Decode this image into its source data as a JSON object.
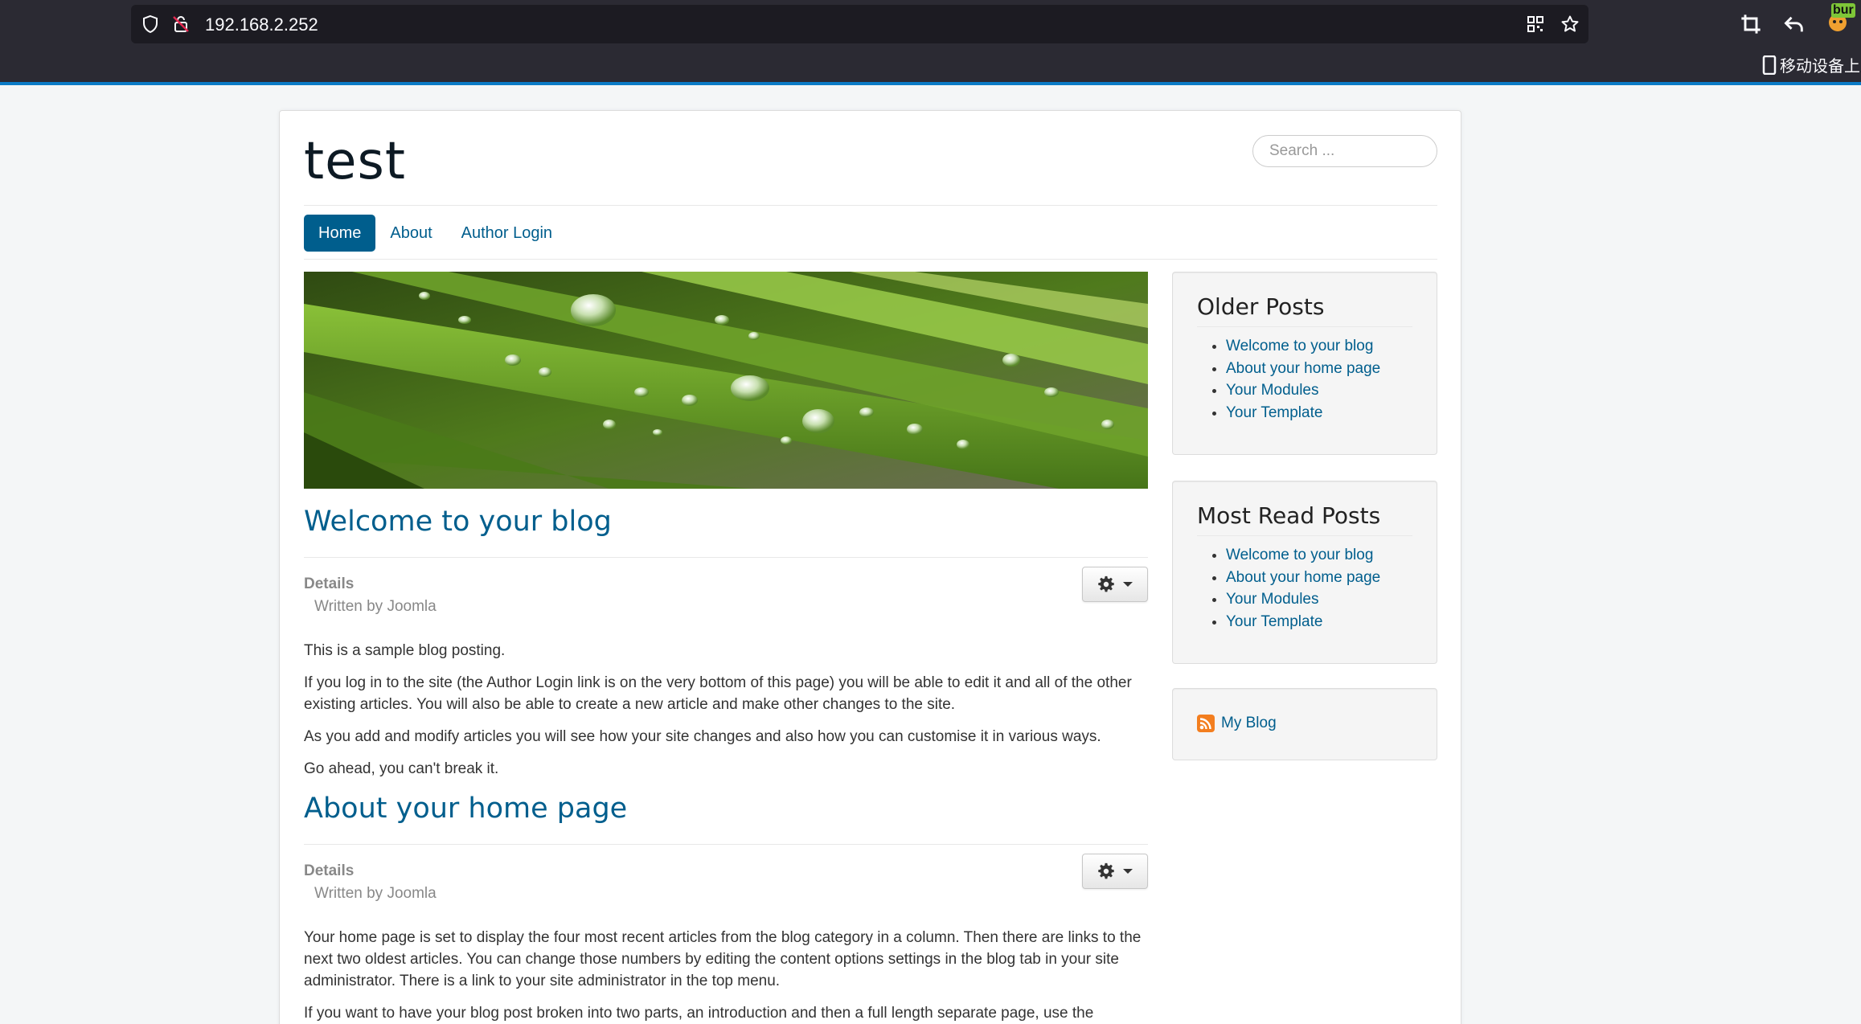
{
  "browser": {
    "url": "192.168.2.252",
    "mobile_note": "移动设备上的",
    "extension_badge": "bur"
  },
  "site": {
    "brand": "test",
    "search_placeholder": "Search ...",
    "nav": [
      {
        "label": "Home",
        "active": true
      },
      {
        "label": "About",
        "active": false
      },
      {
        "label": "Author Login",
        "active": false
      }
    ]
  },
  "articles": [
    {
      "title": "Welcome to your blog",
      "details_label": "Details",
      "written_by": "Written by Joomla",
      "paragraphs": [
        "This is a sample blog posting.",
        "If you log in to the site (the Author Login link is on the very bottom of this page) you will be able to edit it and all of the other existing articles. You will also be able to create a new article and make other changes to the site.",
        "As you add and modify articles you will see how your site changes and also how you can customise it in various ways.",
        "Go ahead, you can't break it."
      ]
    },
    {
      "title": "About your home page",
      "details_label": "Details",
      "written_by": "Written by Joomla",
      "paragraphs": [
        "Your home page is set to display the four most recent articles from the blog category in a column. Then there are links to the next two oldest articles. You can change those numbers by editing the content options settings in the blog tab in your site administrator. There is a link to your site administrator in the top menu.",
        "If you want to have your blog post broken into two parts, an introduction and then a full length separate page, use the"
      ]
    }
  ],
  "sidebar": {
    "older_posts": {
      "title": "Older Posts",
      "items": [
        "Welcome to your blog",
        "About your home page",
        "Your Modules",
        "Your Template"
      ]
    },
    "most_read": {
      "title": "Most Read Posts",
      "items": [
        "Welcome to your blog",
        "About your home page",
        "Your Modules",
        "Your Template"
      ]
    },
    "feed": {
      "label": "My Blog",
      "icon": "rss-feed-icon"
    }
  },
  "colors": {
    "link": "#005e8d",
    "chrome_bg": "#2b2a33",
    "chrome_accent": "#0b7bc6"
  }
}
